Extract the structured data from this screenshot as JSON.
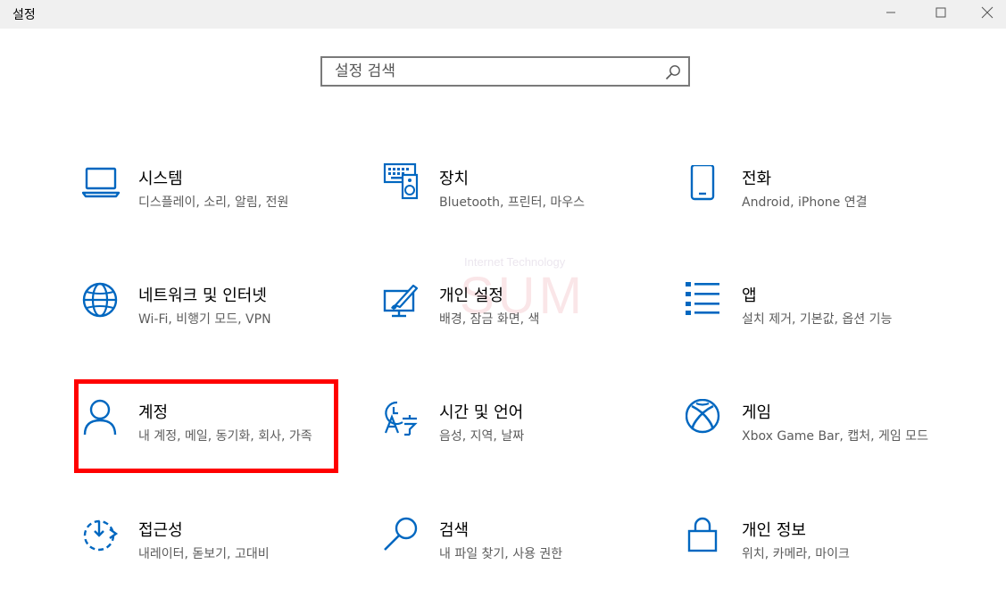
{
  "window": {
    "title": "설정",
    "controls": {
      "minimize": "minimize-icon",
      "maximize": "maximize-icon",
      "close": "close-icon"
    }
  },
  "search": {
    "placeholder": "설정 검색",
    "value": ""
  },
  "accent_color": "#0067c0",
  "highlight_color": "#ff0000",
  "watermark": {
    "small": "Internet Technology",
    "big": "SUM"
  },
  "tiles": [
    {
      "icon": "laptop-icon",
      "name": "시스템",
      "desc": "디스플레이, 소리, 알림, 전원"
    },
    {
      "icon": "keyboard-speaker-icon",
      "name": "장치",
      "desc": "Bluetooth, 프린터, 마우스"
    },
    {
      "icon": "phone-icon",
      "name": "전화",
      "desc": "Android, iPhone 연결"
    },
    {
      "icon": "globe-icon",
      "name": "네트워크 및 인터넷",
      "desc": "Wi-Fi, 비행기 모드, VPN"
    },
    {
      "icon": "paint-brush-icon",
      "name": "개인 설정",
      "desc": "배경, 잠금 화면, 색"
    },
    {
      "icon": "app-list-icon",
      "name": "앱",
      "desc": "설치 제거, 기본값, 옵션 기능"
    },
    {
      "icon": "person-icon",
      "name": "계정",
      "desc": "내 계정, 메일, 동기화, 회사, 가족"
    },
    {
      "icon": "time-language-icon",
      "name": "시간 및 언어",
      "desc": "음성, 지역, 날짜"
    },
    {
      "icon": "xbox-icon",
      "name": "게임",
      "desc": "Xbox Game Bar, 캡처, 게임 모드"
    },
    {
      "icon": "accessibility-timer-icon",
      "name": "접근성",
      "desc": "내레이터, 돋보기, 고대비"
    },
    {
      "icon": "search-icon",
      "name": "검색",
      "desc": "내 파일 찾기, 사용 권한"
    },
    {
      "icon": "lock-icon",
      "name": "개인 정보",
      "desc": "위치, 카메라, 마이크"
    }
  ]
}
